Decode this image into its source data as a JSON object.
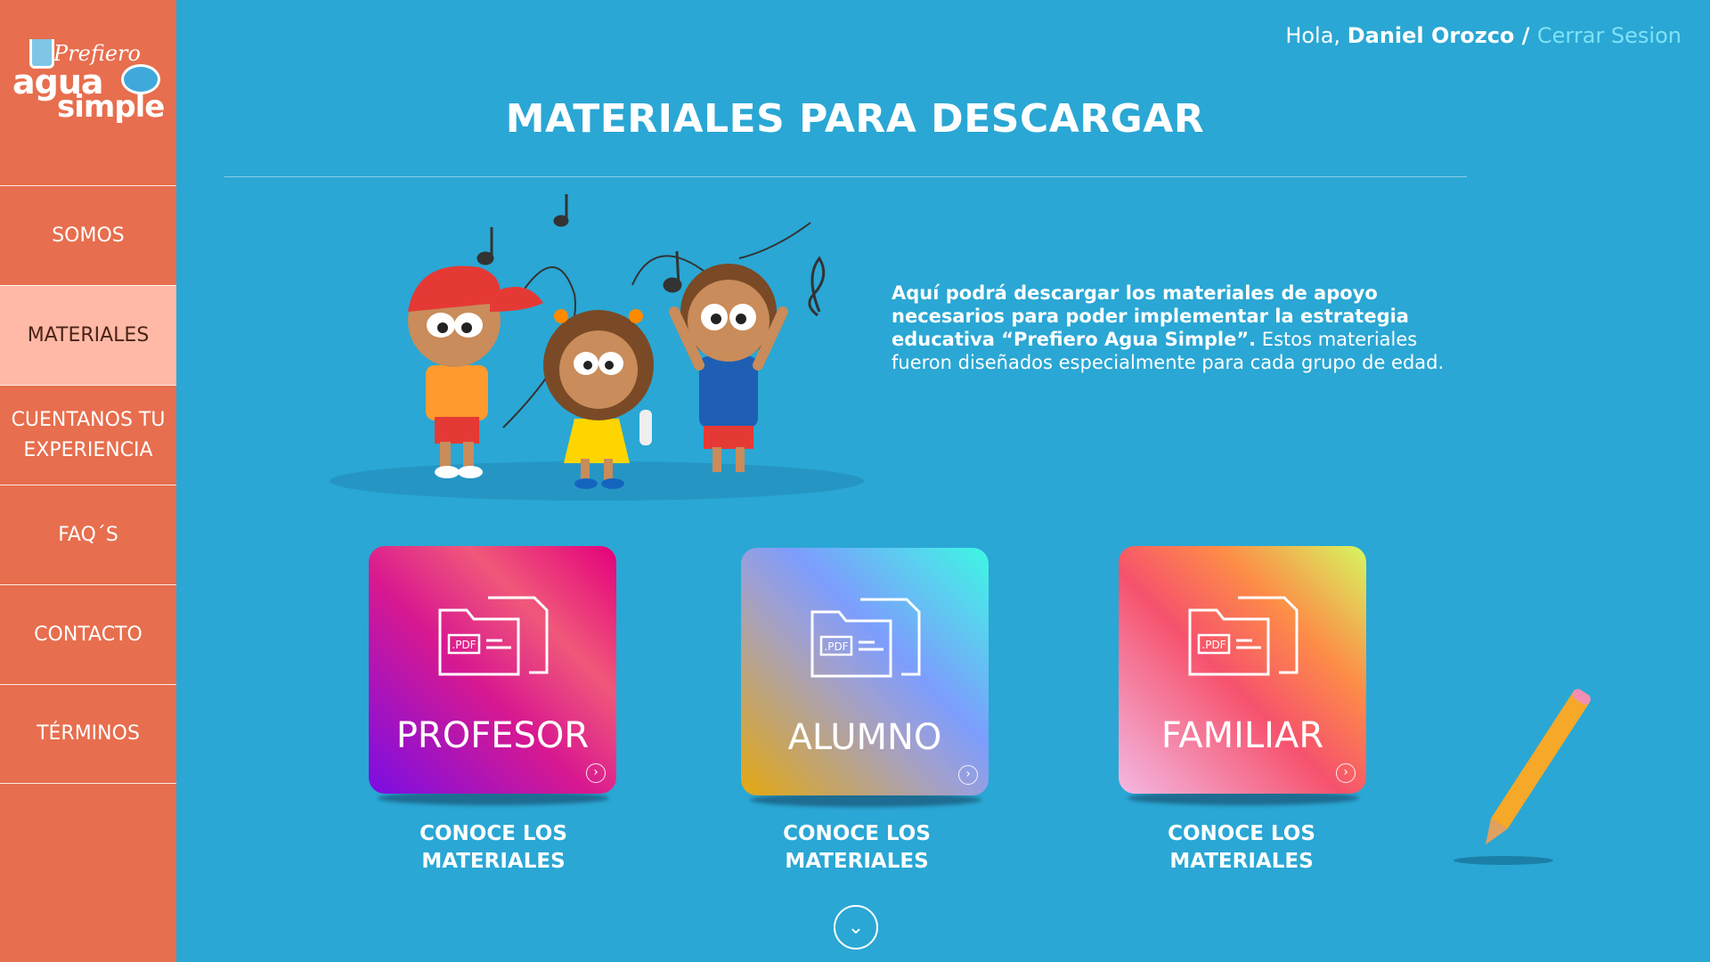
{
  "logo": {
    "line1": "Prefiero",
    "line2": "agua",
    "line3": "simple"
  },
  "nav": {
    "items": [
      {
        "label": "SOMOS"
      },
      {
        "label": "MATERIALES"
      },
      {
        "label": "CUENTANOS TU EXPERIENCIA"
      },
      {
        "label": "FAQ´S"
      },
      {
        "label": "CONTACTO"
      },
      {
        "label": "TÉRMINOS"
      }
    ]
  },
  "header": {
    "greeting": "Hola, ",
    "user_name": "Daniel Orozco",
    "separator": " / ",
    "logout": "Cerrar Sesion"
  },
  "page": {
    "title": "MATERIALES PARA DESCARGAR",
    "intro_bold": "Aquí podrá descargar los materiales de apoyo necesarios para poder implementar la estrategia educativa “Prefiero Agua Simple”.",
    "intro_rest": " Estos materiales fueron diseñados especialmente para cada grupo de edad."
  },
  "cards": [
    {
      "title": "PROFESOR",
      "cta": "CONOCE LOS MATERIALES",
      "pdf_label": ".PDF"
    },
    {
      "title": "ALUMNO",
      "cta": "CONOCE LOS MATERIALES",
      "pdf_label": ".PDF"
    },
    {
      "title": "FAMILIAR",
      "cta": "CONOCE LOS MATERIALES",
      "pdf_label": ".PDF"
    }
  ],
  "colors": {
    "background": "#2aa7d4",
    "sidebar": "#e76e4e",
    "sidebar_active": "#ffb9a6",
    "logout_link": "#7ee2f7"
  }
}
